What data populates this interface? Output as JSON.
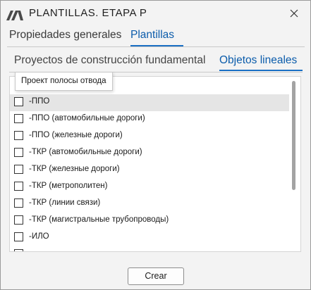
{
  "window": {
    "title": "PLANTILLAS. ETAPA P"
  },
  "top_tabs": [
    {
      "label": "Propiedades generales",
      "active": false
    },
    {
      "label": "Plantillas",
      "active": true
    }
  ],
  "sub_tabs": [
    {
      "label": "Proyectos de construcción fundamental",
      "active": false
    },
    {
      "label": "Objetos lineales",
      "active": true
    }
  ],
  "tooltip": {
    "text": "Проект полосы отвода"
  },
  "list": {
    "items": [
      {
        "label": "-ППО",
        "checked": false,
        "highlighted": true
      },
      {
        "label": "-ППО (автомобильные дороги)",
        "checked": false
      },
      {
        "label": "-ППО (железные дороги)",
        "checked": false
      },
      {
        "label": "-ТКР (автомобильные дороги)",
        "checked": false
      },
      {
        "label": "-ТКР (железные дороги)",
        "checked": false
      },
      {
        "label": "-ТКР (метрополитен)",
        "checked": false
      },
      {
        "label": "-ТКР (линии связи)",
        "checked": false
      },
      {
        "label": "-ТКР (магистральные трубопроводы)",
        "checked": false
      },
      {
        "label": "-ИЛО",
        "checked": false
      }
    ]
  },
  "footer": {
    "create_label": "Crear"
  },
  "colors": {
    "accent": "#0b5cab",
    "highlight_row": "#e5e5e5",
    "window_bg": "#f3f3f3"
  },
  "icons": {
    "app": "app-logo-icon",
    "close": "close-icon"
  }
}
